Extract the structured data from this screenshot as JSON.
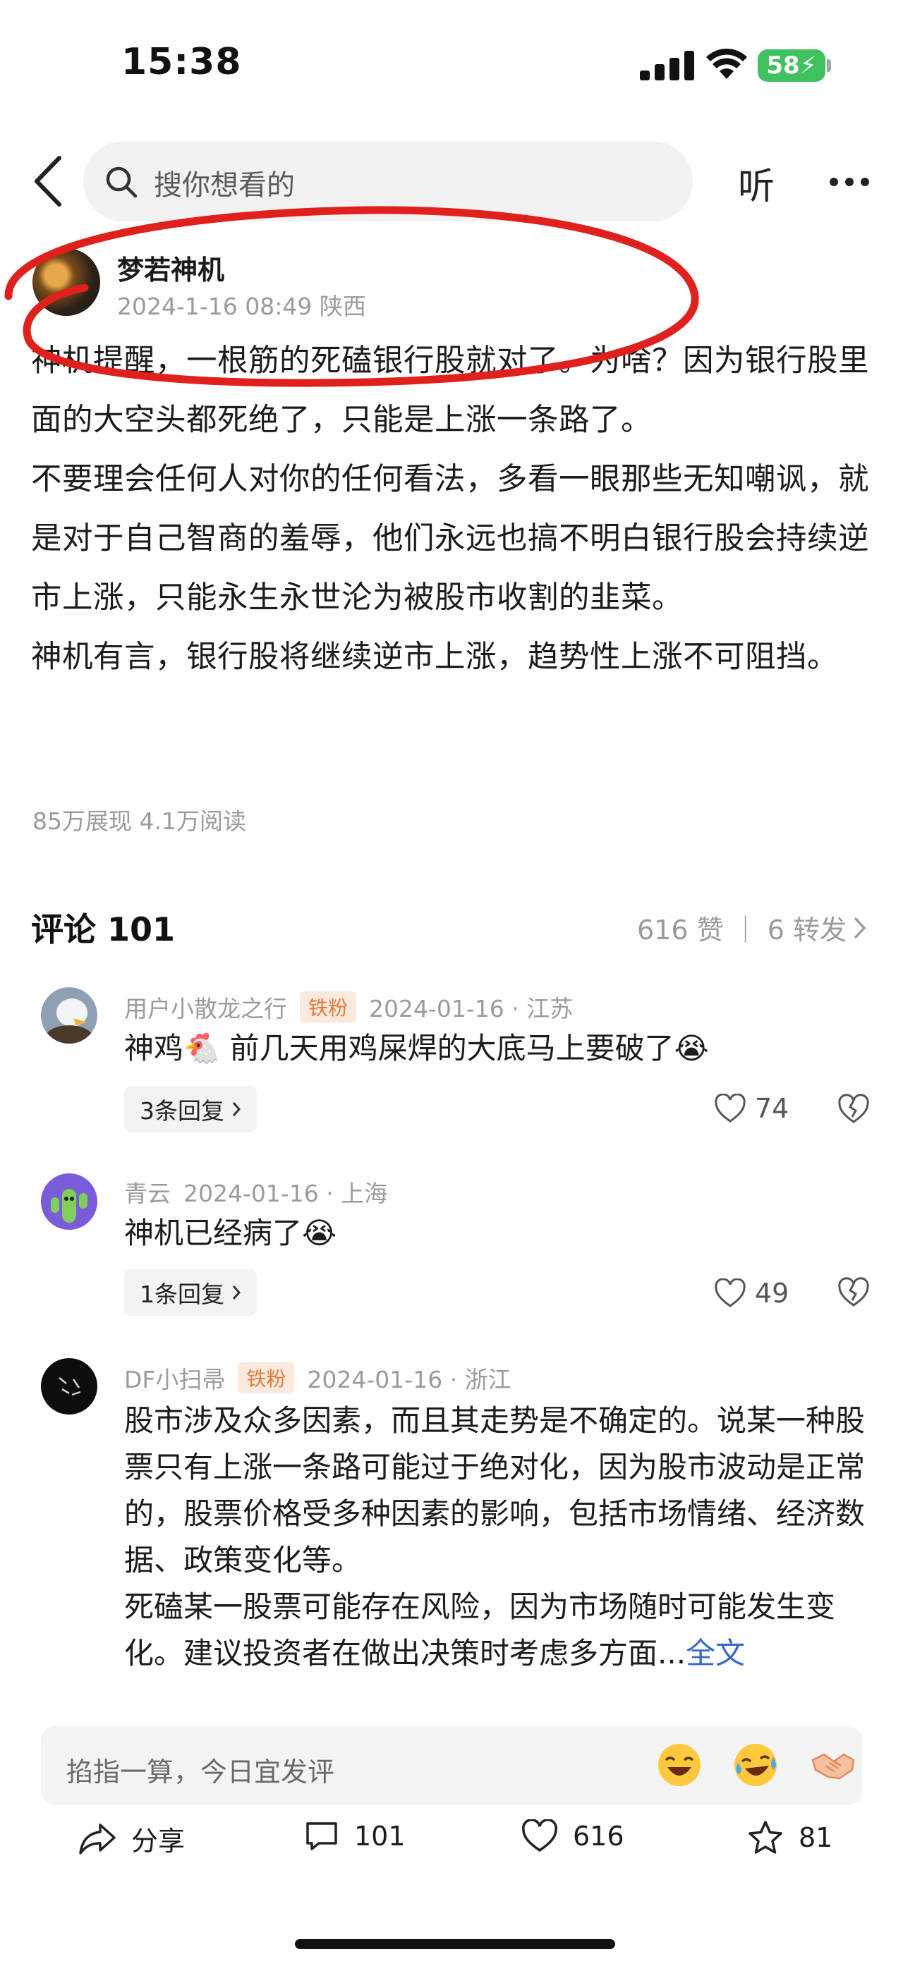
{
  "status": {
    "time": "15:38",
    "battery": "58"
  },
  "nav": {
    "search_placeholder": "搜你想看的",
    "listen_label": "听"
  },
  "post": {
    "author": "梦若神机",
    "meta": "2024-1-16 08:49  陕西",
    "paragraphs": [
      "神机提醒，一根筋的死磕银行股就对了。为啥？因为银行股里面的大空头都死绝了，只能是上涨一条路了。",
      "不要理会任何人对你的任何看法，多看一眼那些无知嘲讽，就是对于自己智商的羞辱，他们永远也搞不明白银行股会持续逆市上涨，只能永生永世沦为被股市收割的韭菜。",
      "神机有言，银行股将继续逆市上涨，趋势性上涨不可阻挡。"
    ],
    "stats": "85万展现   4.1万阅读"
  },
  "comments_header": {
    "title": "评论 101",
    "summary": "616 赞 ｜ 6 转发"
  },
  "comments": [
    {
      "user": "用户小散龙之行",
      "badge": "铁粉",
      "meta": "2024-01-16 · 江苏",
      "text": "神鸡🐔 前几天用鸡屎焊的大底马上要破了😭",
      "replies": "3条回复",
      "likes": "74"
    },
    {
      "user": "青云",
      "meta": "2024-01-16 · 上海",
      "text": "神机已经病了😭",
      "replies": "1条回复",
      "likes": "49"
    },
    {
      "user": "DF小扫帚",
      "badge": "铁粉",
      "meta": "2024-01-16 · 浙江",
      "text_lines": [
        "股市涉及众多因素，而且其走势是不确定的。说某一种股票只有上涨一条路可能过于绝对化，因为股市波动是正常的，股票价格受多种因素的影响，包括市场情绪、经济数据、政策变化等。",
        "死磕某一股票可能存在风险，因为市场随时可能发生变化。建议投资者在做出决策时考虑多方面..."
      ],
      "full_text_link": "全文"
    }
  ],
  "input": {
    "placeholder": "掐指一算，今日宜发评"
  },
  "actions": {
    "share": "分享",
    "comments": "101",
    "likes": "616",
    "favorites": "81"
  },
  "colors": {
    "battery": "#3fc160",
    "badge_bg": "#fbe9dd",
    "badge_text": "#e27c3c",
    "link": "#3568c9",
    "annotation": "#e0201c"
  }
}
